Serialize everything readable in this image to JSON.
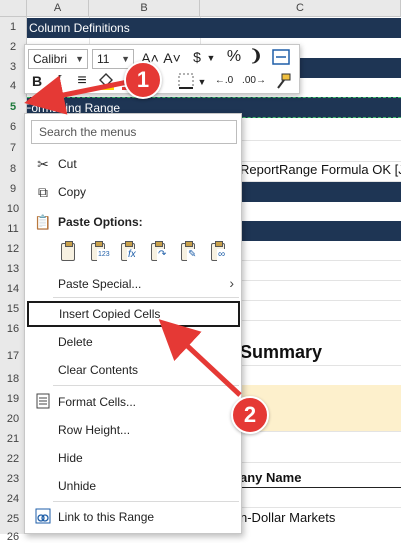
{
  "sheet": {
    "columns": [
      "A",
      "B",
      "C"
    ],
    "rows": [
      "1",
      "2",
      "3",
      "4",
      "5",
      "6",
      "7",
      "8",
      "9",
      "10",
      "11",
      "12",
      "13",
      "14",
      "15",
      "16",
      "17",
      "18",
      "19",
      "20",
      "21",
      "22",
      "23",
      "24",
      "25",
      "26"
    ],
    "cells": {
      "row1_title": "Column Definitions",
      "row5_title": "Formatting Range",
      "row8_text": "ReportRange Formula OK [J",
      "summary": "Summary",
      "company_header": "any Name",
      "row25_text": "n-Dollar Markets"
    }
  },
  "mini_toolbar": {
    "font_name": "Calibri",
    "font_size": "11",
    "grow_font": "A˄",
    "shrink_font": "A˅",
    "currency": "$",
    "percent": "%",
    "comma": "❩",
    "bold": "B",
    "italic": "I",
    "align": "≡",
    "decimal_inc": "←.0",
    "decimal_dec": ".00→"
  },
  "context_menu": {
    "search_placeholder": "Search the menus",
    "items": {
      "cut": "Cut",
      "copy": "Copy",
      "paste_options": "Paste Options:",
      "paste_special": "Paste Special...",
      "insert_copied_cells": "Insert Copied Cells",
      "delete": "Delete",
      "clear_contents": "Clear Contents",
      "format_cells": "Format Cells...",
      "row_height": "Row Height...",
      "hide": "Hide",
      "unhide": "Unhide",
      "link_to_range": "Link to this Range"
    },
    "paste_icons": [
      "paste-icon",
      "paste-values-icon",
      "paste-formulas-icon",
      "paste-transpose-icon",
      "paste-formatting-icon",
      "paste-link-icon"
    ],
    "paste_glyphs": [
      "",
      "123",
      "fx",
      "↷",
      "✎",
      "∞"
    ]
  },
  "annotations": {
    "badge1": "1",
    "badge2": "2",
    "arrow_color": "#e53935"
  },
  "colors": {
    "header_band": "#1e3554",
    "highlight_yellow": "#fdf0cc",
    "selection_green": "#3cc06a"
  }
}
